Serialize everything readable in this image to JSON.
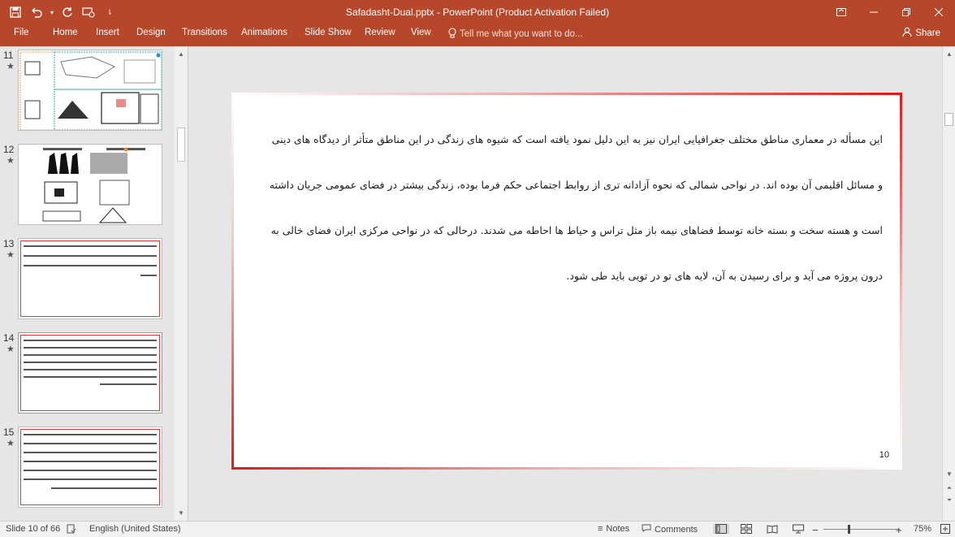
{
  "window": {
    "title": "Safadasht-Dual.pptx - PowerPoint (Product Activation Failed)"
  },
  "ribbon": {
    "file": "File",
    "tabs": [
      "Home",
      "Insert",
      "Design",
      "Transitions",
      "Animations",
      "Slide Show",
      "Review",
      "View"
    ],
    "tellme": "Tell me what you want to do...",
    "share": "Share"
  },
  "thumbnails": [
    {
      "number": "11",
      "star": "★"
    },
    {
      "number": "12",
      "star": "★"
    },
    {
      "number": "13",
      "star": "★"
    },
    {
      "number": "14",
      "star": "★"
    },
    {
      "number": "15",
      "star": "★"
    }
  ],
  "slide": {
    "lines": [
      "این مسأله در معماری مناطق مختلف جغرافیایی ایران نیز به این دلیل نمود یافته است که شیوه های زندگی در این مناطق متأثر از دیدگاه های دینی",
      "و مسائل اقلیمی آن بوده اند. در نواحی شمالی که نحوه آزادانه تری از روابط اجتماعی حکم فرما بوده، زندگی بیشتر در فضای عمومی جریان داشته",
      "است و هسته سخت و بسته خانه توسط فضاهای نیمه باز مثل تراس و حیاط ها احاطه می شدند. درحالی که در نواحی مرکزی ایران فضای خالی به",
      "درون پروژه می آید و برای رسیدن به آن، لایه های تو در تویی باید طی شود."
    ],
    "page_number": "10"
  },
  "status": {
    "slide_info": "Slide 10 of 66",
    "language": "English (United States)",
    "notes": "Notes",
    "comments": "Comments",
    "zoom": "75%"
  },
  "colors": {
    "accent": "#b7472a",
    "slide_border": "#e01818"
  }
}
